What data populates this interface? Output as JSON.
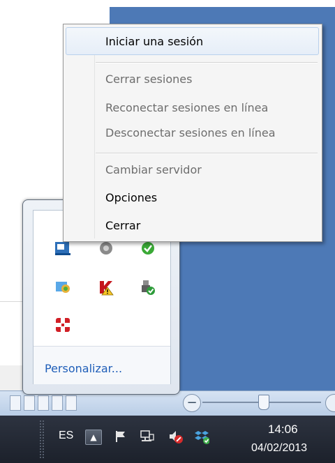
{
  "context_menu": {
    "items": [
      {
        "label": "Iniciar una sesión",
        "enabled": true
      },
      {
        "label": "Cerrar sesiones",
        "enabled": false
      },
      {
        "label": "Reconectar sesiones en línea",
        "enabled": false
      },
      {
        "label": "Desconectar sesiones en línea",
        "enabled": false
      },
      {
        "label": "Cambiar servidor",
        "enabled": false
      },
      {
        "label": "Opciones",
        "enabled": true
      },
      {
        "label": "Cerrar",
        "enabled": true
      }
    ]
  },
  "tray_overflow": {
    "icons": [
      "blue-app-icon",
      "gray-app-icon",
      "green-app-icon",
      "network-globe-icon",
      "kaspersky-warning-icon",
      "usb-safe-remove-icon",
      "fortinet-icon"
    ],
    "customize_label": "Personalizar..."
  },
  "taskbar": {
    "language": "ES",
    "show_hidden_icon": "caret-up-icon",
    "tray_icons": [
      "action-center-flag-icon",
      "network-icon",
      "volume-muted-icon",
      "dropbox-icon"
    ],
    "clock_time": "14:06",
    "clock_date": "04/02/2013"
  },
  "colors": {
    "desktop_blue": "#4d79b6",
    "taskbar": "#252a35",
    "link_blue": "#1f5eb8"
  }
}
